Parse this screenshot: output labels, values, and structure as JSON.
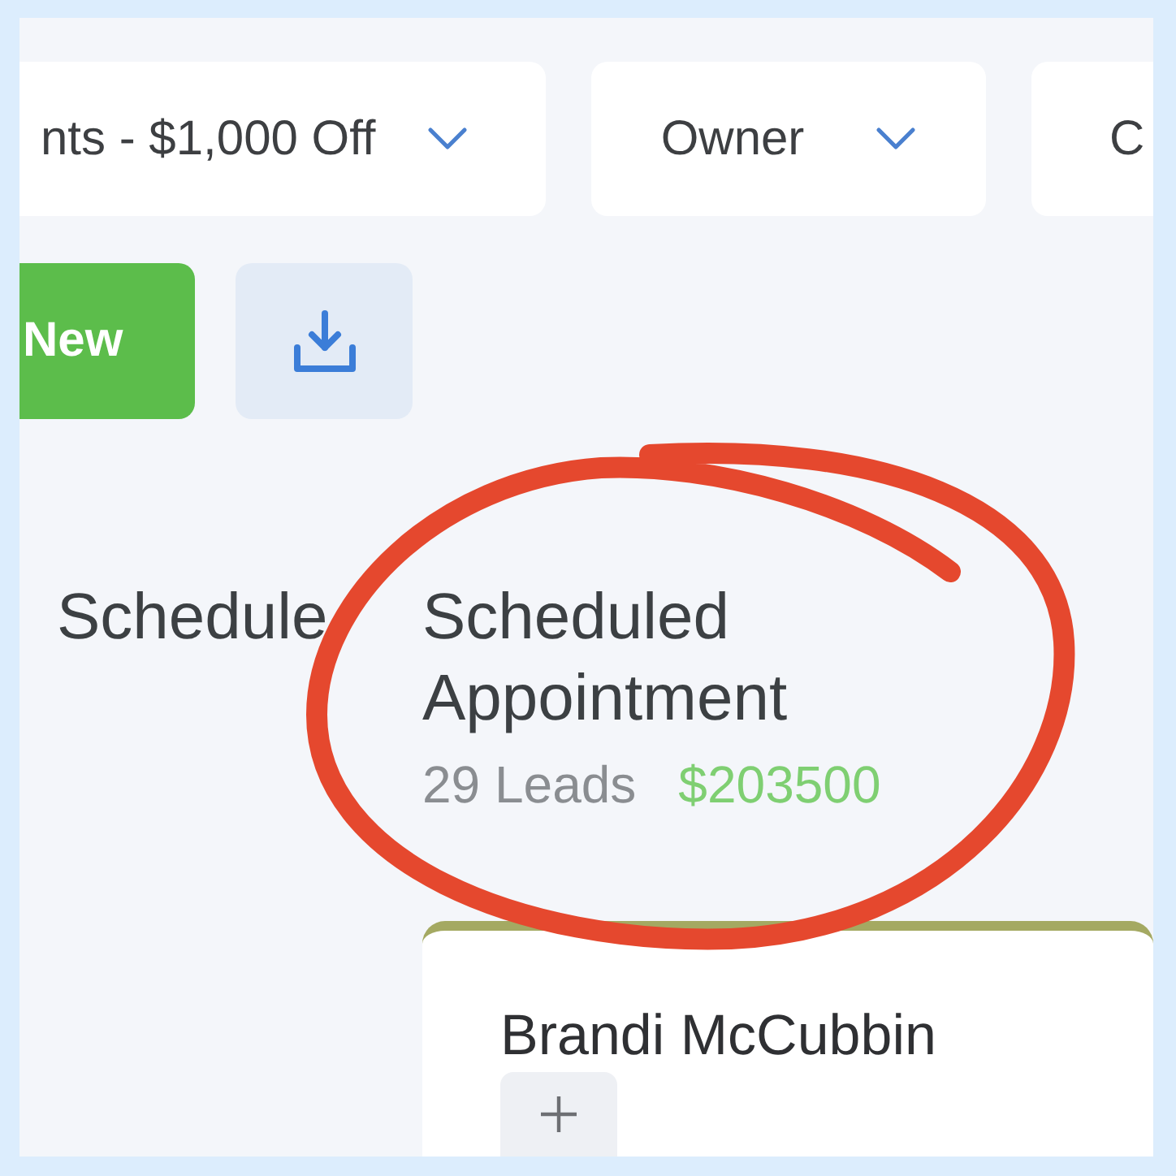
{
  "filters": [
    {
      "label": "nts - $1,000 Off",
      "chevron": true
    },
    {
      "label": "Owner",
      "chevron": true
    },
    {
      "label": "C",
      "chevron": false
    }
  ],
  "buttons": [
    {
      "kind": "primary",
      "label": "New"
    },
    {
      "kind": "download"
    }
  ],
  "columns": [
    {
      "title": "Schedule",
      "circled": false
    },
    {
      "title": "Scheduled Appointment",
      "leads": "29 Leads",
      "amount": "$203500",
      "circled": true,
      "cards": [
        {
          "name": "Brandi McCubbin"
        }
      ]
    }
  ]
}
